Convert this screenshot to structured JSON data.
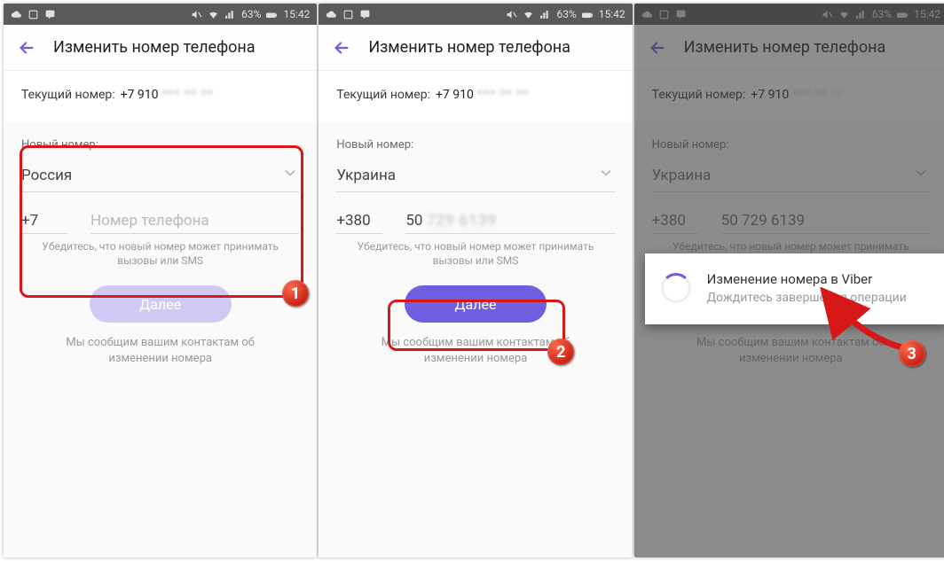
{
  "statusbar": {
    "battery": "63%",
    "time": "15:42"
  },
  "appbar": {
    "title": "Изменить номер телефона"
  },
  "current": {
    "label": "Текущий номер:",
    "value_visible": "+7 910",
    "value_hidden": "*** ** **"
  },
  "form": {
    "section_label": "Новый номер:",
    "phone_placeholder": "Номер телефона",
    "hint_line1": "Убедитесь, что новый номер может принимать",
    "hint_line2": "вызовы или SMS",
    "button": "Далее",
    "foot_line1": "Мы сообщим вашим контактам об",
    "foot_line2": "изменении номера"
  },
  "panel1": {
    "country": "Россия",
    "cc": "+7",
    "num_visible": "",
    "num_hidden": ""
  },
  "panel2": {
    "country": "Украина",
    "cc": "+380",
    "num_visible": "50",
    "num_hidden": "729 6139"
  },
  "panel3": {
    "country": "Украина",
    "cc": "+380",
    "num_display": "50 729 6139",
    "dialog_title": "Изменение номера в Viber",
    "dialog_msg": "Дождитесь завершения операции"
  },
  "callouts": {
    "n1": "1",
    "n2": "2",
    "n3": "3"
  }
}
